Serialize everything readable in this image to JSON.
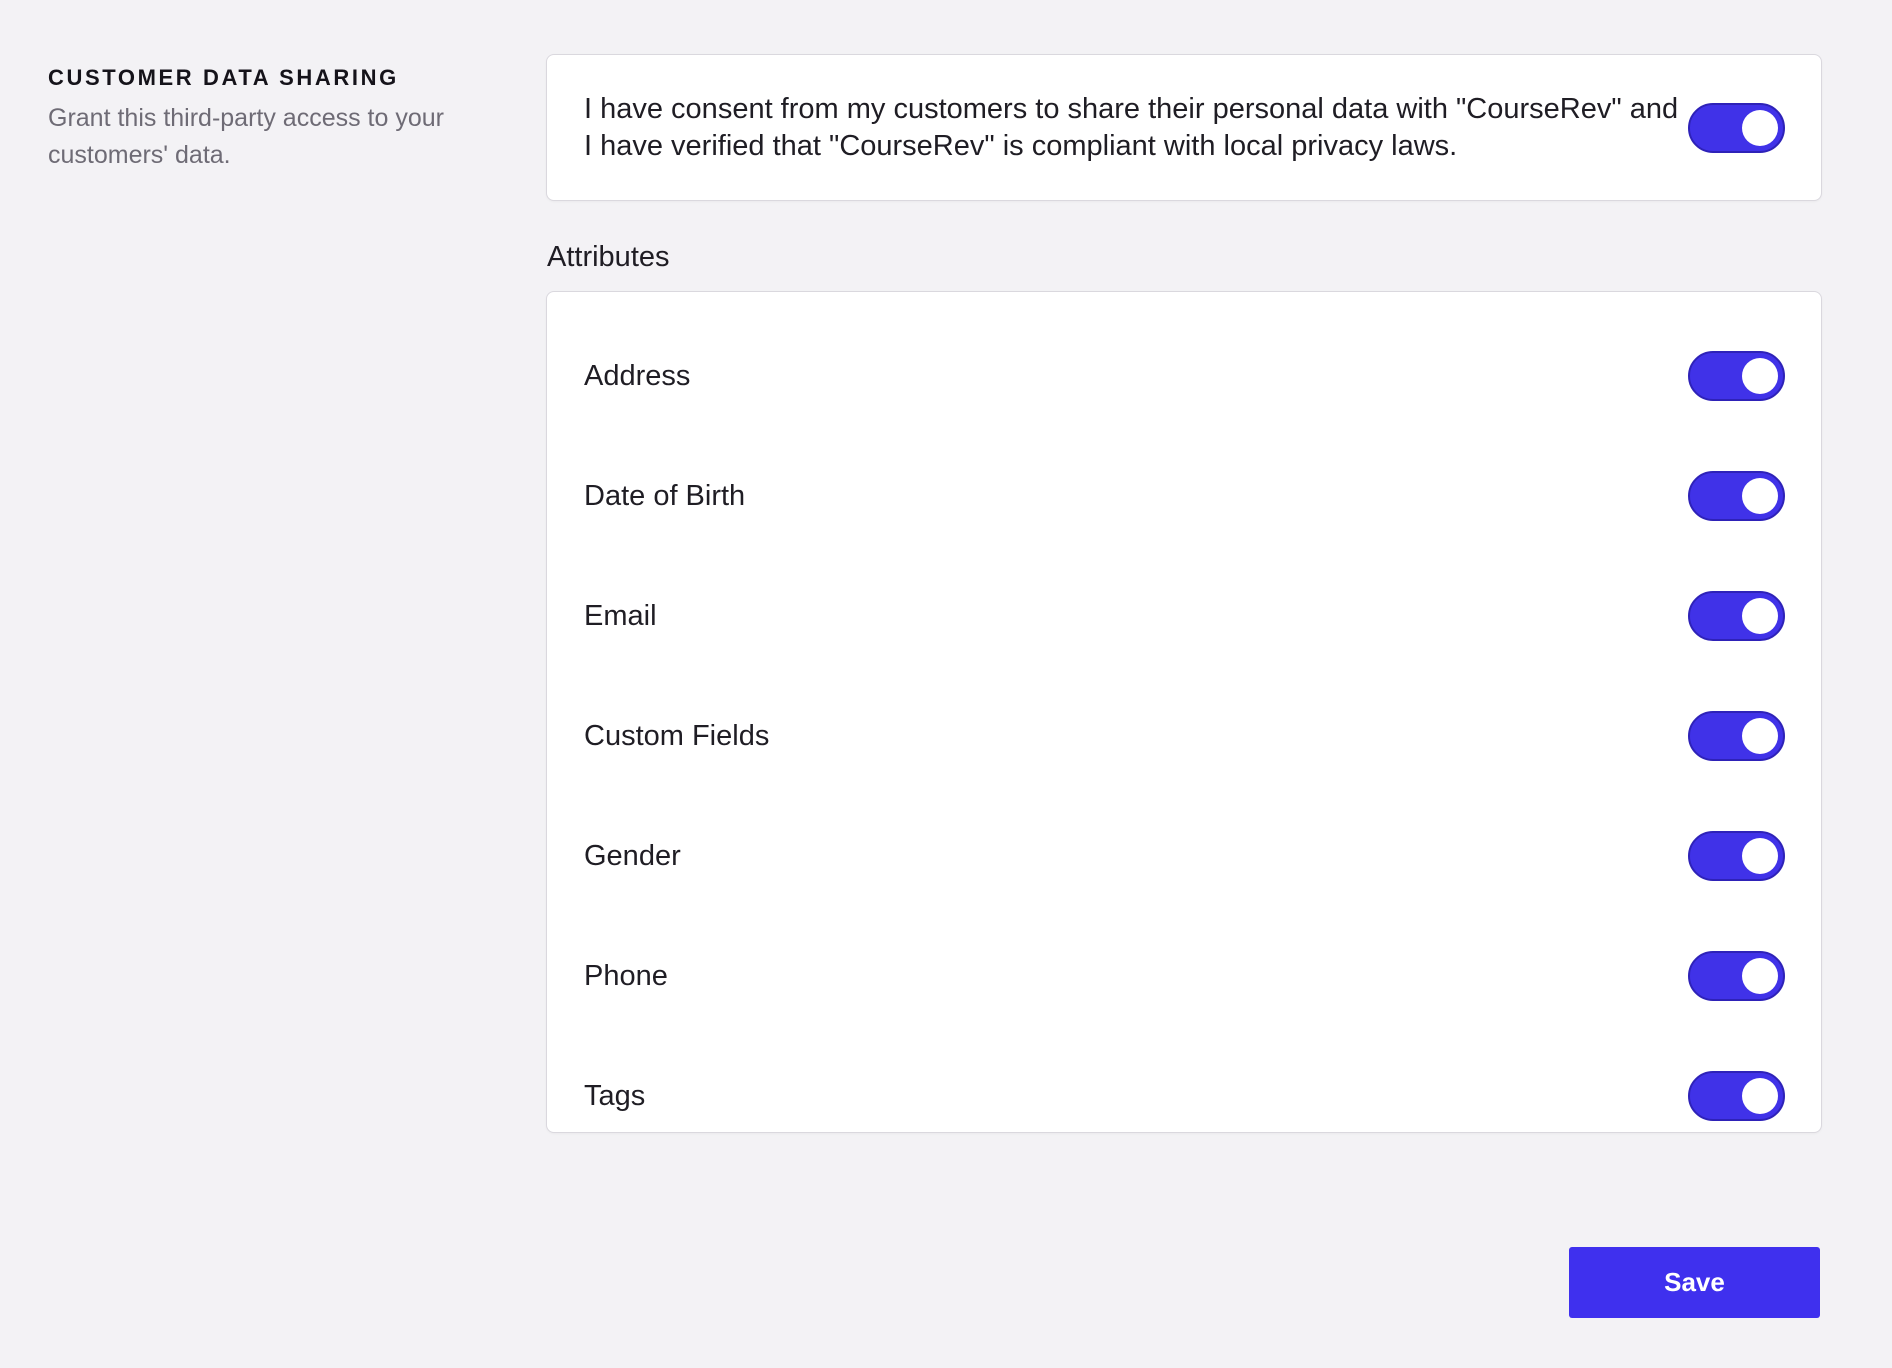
{
  "section": {
    "title": "CUSTOMER DATA SHARING",
    "description": "Grant this third-party access to your customers' data."
  },
  "consent": {
    "text": "I have consent from my customers to share their personal data with \"CourseRev\" and I have verified that \"CourseRev\" is compliant with local privacy laws.",
    "enabled": true
  },
  "attributes": {
    "label": "Attributes",
    "items": [
      {
        "label": "Address",
        "enabled": true
      },
      {
        "label": "Date of Birth",
        "enabled": true
      },
      {
        "label": "Email",
        "enabled": true
      },
      {
        "label": "Custom Fields",
        "enabled": true
      },
      {
        "label": "Gender",
        "enabled": true
      },
      {
        "label": "Phone",
        "enabled": true
      },
      {
        "label": "Tags",
        "enabled": true
      }
    ]
  },
  "actions": {
    "save_label": "Save"
  },
  "colors": {
    "accent": "#4032e8",
    "background": "#f3f2f5"
  }
}
